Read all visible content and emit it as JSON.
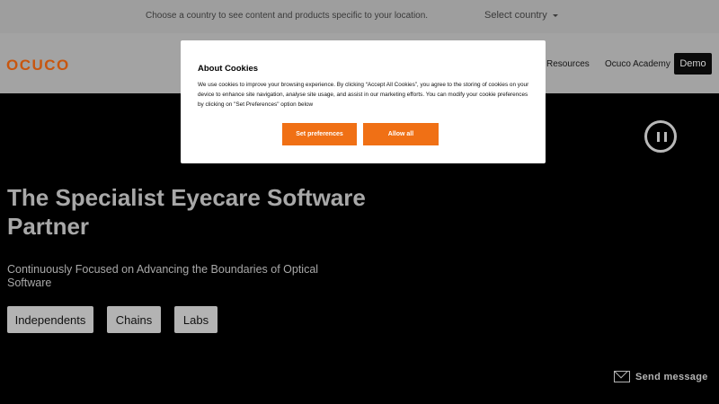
{
  "country_bar": {
    "message": "Choose a country to see content and products specific to your location.",
    "select_label": "Select country"
  },
  "navbar": {
    "logo": "OCUCO",
    "items": [
      "Resources",
      "Ocuco Academy"
    ],
    "demo_label": "Demo"
  },
  "hero": {
    "title": "The Specialist Eyecare Software Partner",
    "subtitle": "Continuously Focused on Advancing the Boundaries of Optical Software",
    "buttons": [
      "Independents",
      "Chains",
      "Labs"
    ],
    "send_message": "Send message"
  },
  "cookie_modal": {
    "title": "About Cookies",
    "text": "We use cookies to improve your browsing experience. By clicking “Accept All Cookies”, you agree to the storing of cookies on your device to enhance site navigation, analyse site usage, and assist in our marketing efforts. You can modify your cookie preferences by clicking on \"Set Preferences\" option below",
    "set_preferences_label": "Set preferences",
    "allow_all_label": "Allow all"
  },
  "colors": {
    "brand_orange": "#f07015",
    "logo_orange": "#c8560f",
    "overlay_gray": "#9e9e9e"
  },
  "icons": [
    "caret-down-icon",
    "pause-icon",
    "mail-icon"
  ]
}
